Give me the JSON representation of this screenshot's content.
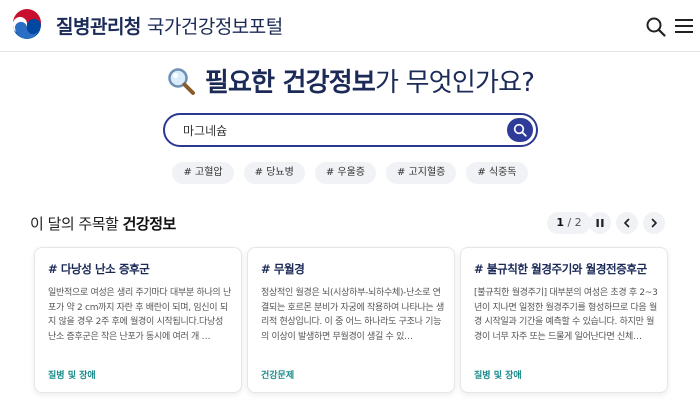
{
  "header": {
    "dept": "질병관리청",
    "portal": "국가건강정보포털"
  },
  "hero": {
    "q_bold": "필요한 건강정보",
    "q_rest": "가 무엇인가요?"
  },
  "search": {
    "value": "마그네슘",
    "placeholder": ""
  },
  "tags": [
    "# 고혈압",
    "# 당뇨병",
    "# 우울증",
    "# 고지혈증",
    "# 식중독"
  ],
  "section": {
    "title_pre": "이 달의 주목할 ",
    "title_bold": "건강정보",
    "page_current": "1",
    "page_sep": " / ",
    "page_total": "2"
  },
  "cards": [
    {
      "title": "# 다낭성 난소 증후군",
      "body": "일반적으로 여성은 생리 주기마다 대부분 하나의 난포가 약 2 cm까지 자란 후 배란이 되며, 임신이 되지 않을 경우 2주 후에 월경이 시작됩니다.다낭성 난소 증후군은 작은 난포가 동시에 여러 개 …",
      "category": "질병 및 장애"
    },
    {
      "title": "# 무월경",
      "body": " 정상적인 월경은 뇌(시상하부-뇌하수체)-난소로 연결되는 호르몬 분비가 자궁에 작용하여 나타나는 생리적 현상입니다. 이 중 어느 하나라도 구조나 기능의 이상이 발생하면 무월경이 생길 수 있…",
      "category": "건강문제"
    },
    {
      "title": "# 불규칙한 월경주기와 월경전증후군",
      "body": "[불규칙한 월경주기] 대부분의 여성은 초경 후 2~3년이 지나면 일정한 월경주기를 형성하므로 다음 월경 시작일과 기간을 예측할 수 있습니다. 하지만 월경이 너무 자주 또는 드물게 일어난다면 신체…",
      "category": "질병 및 장애"
    }
  ],
  "colors": {
    "navy": "#1b2a57",
    "accent": "#2e3b98",
    "category": "#1a8a8a"
  }
}
